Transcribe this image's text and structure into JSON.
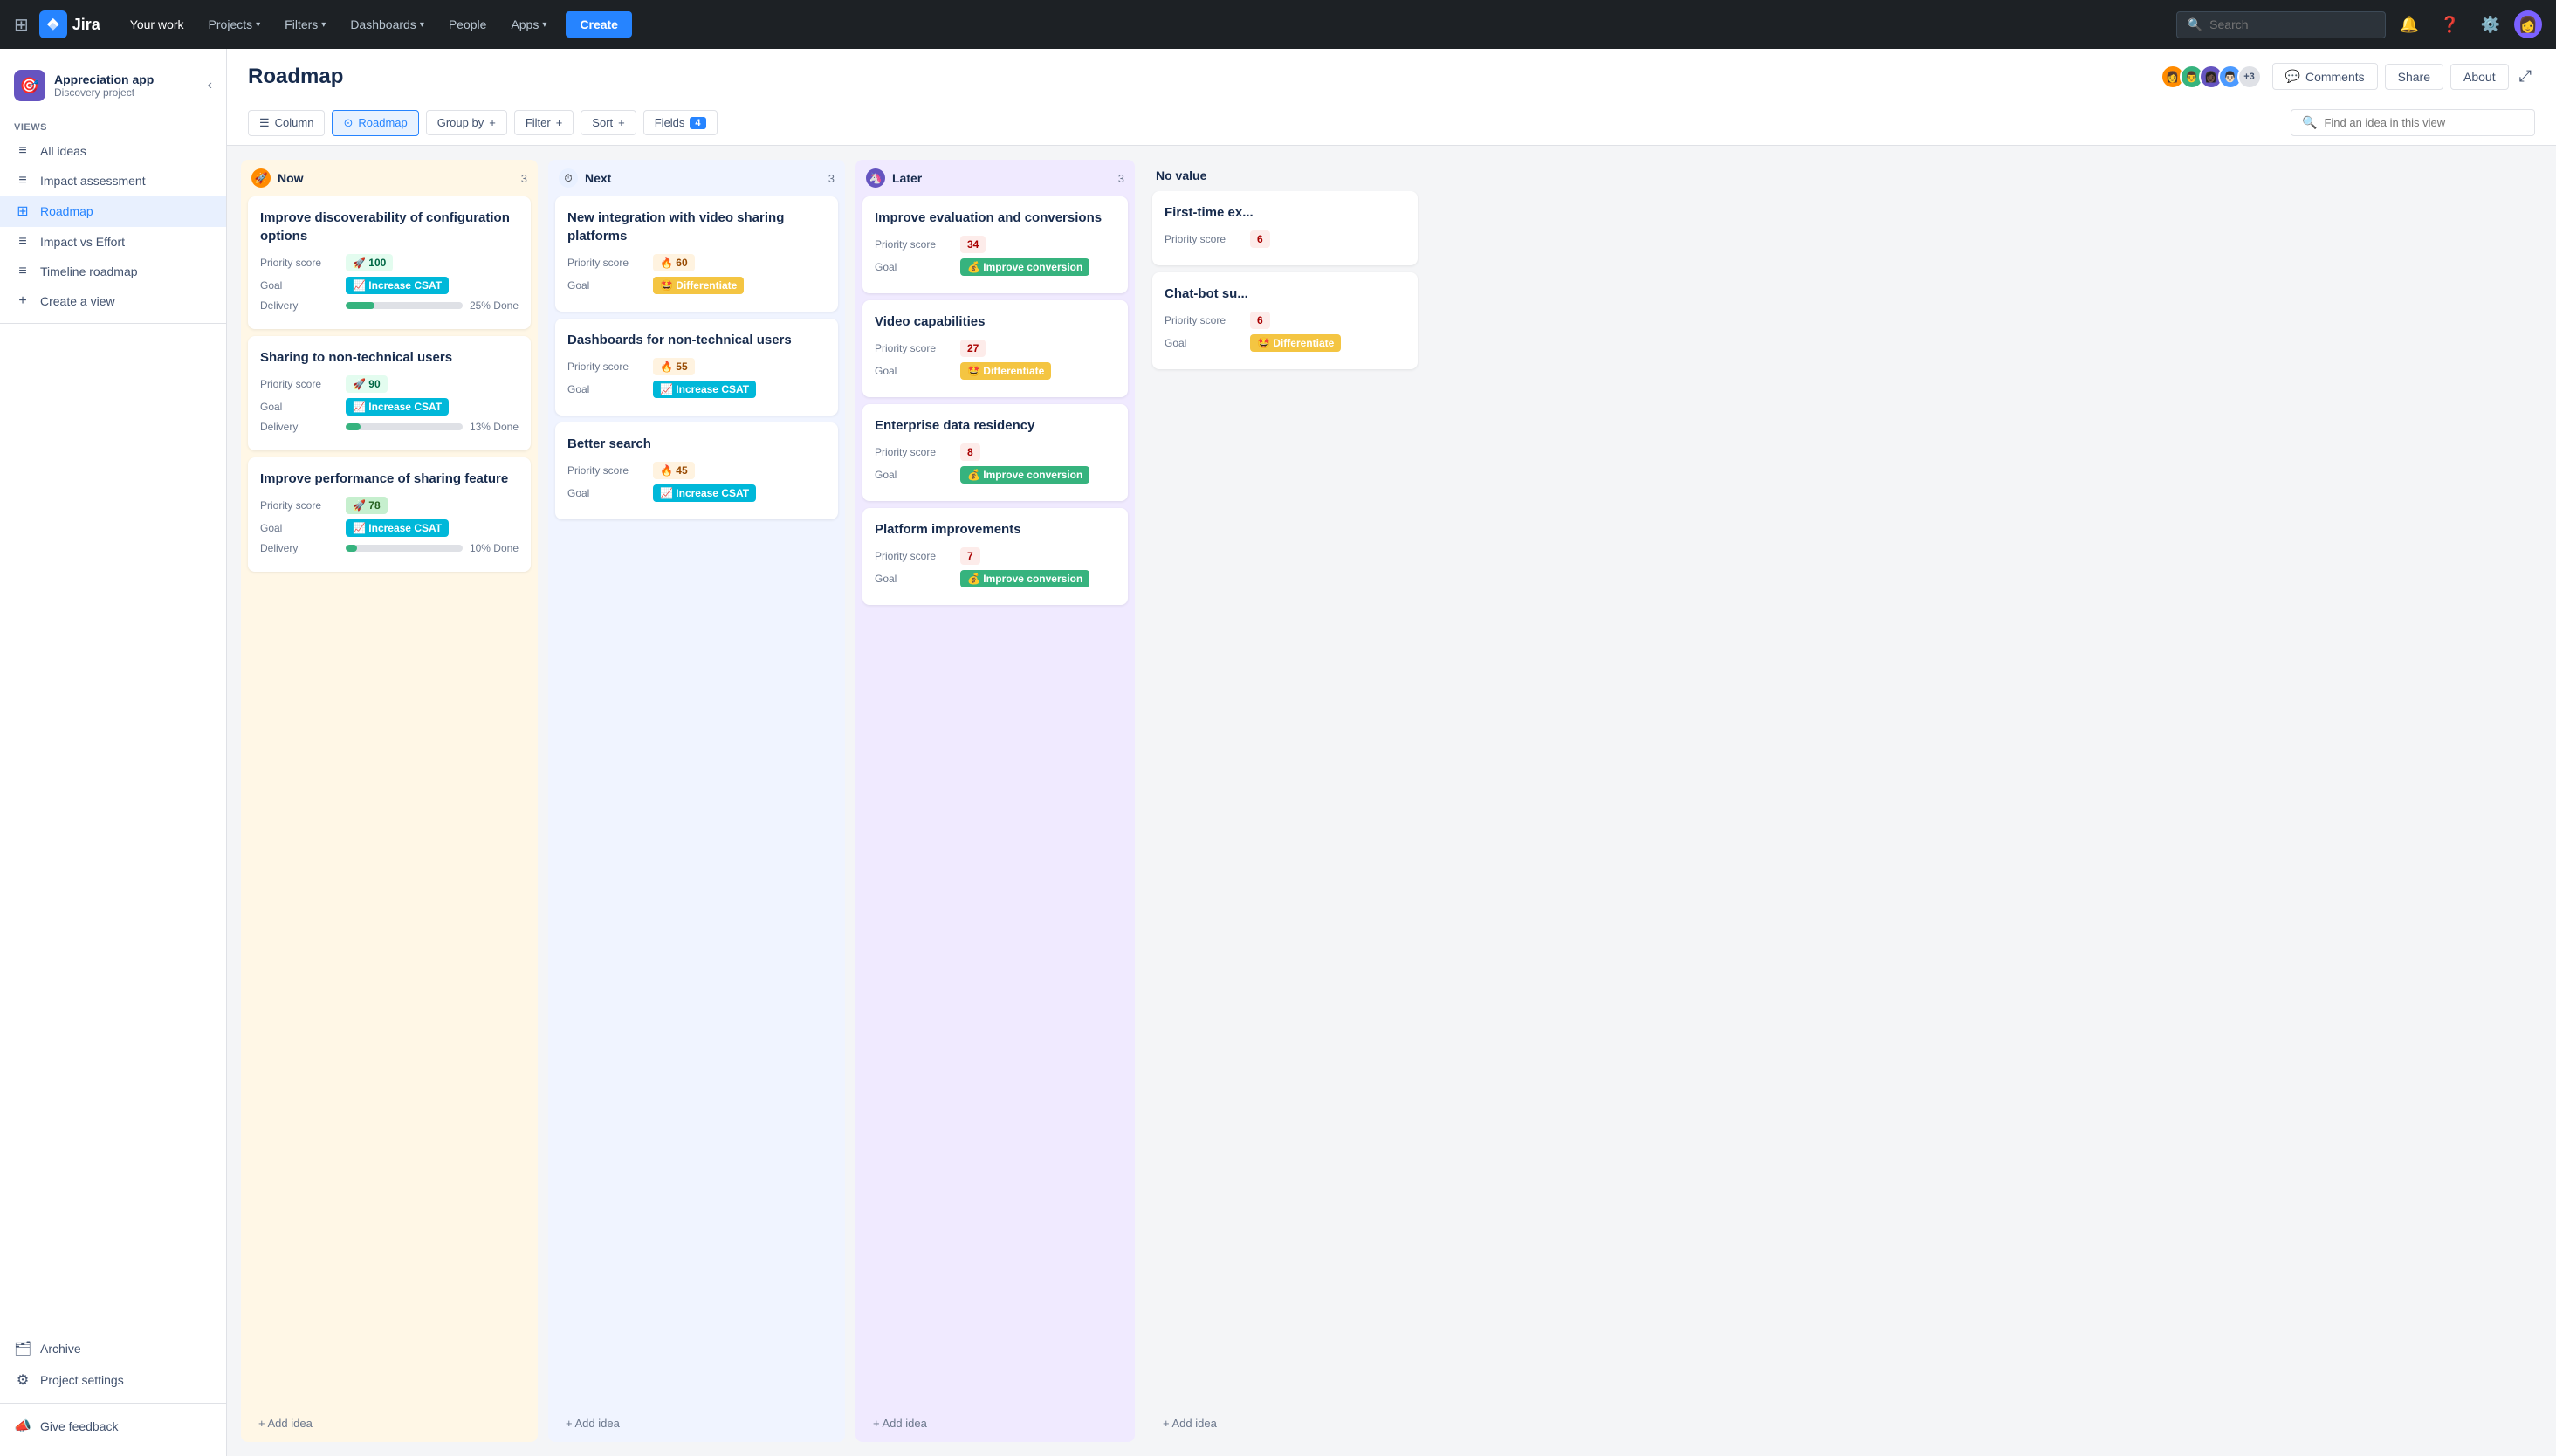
{
  "nav": {
    "logo_text": "Jira",
    "links": [
      "Your work",
      "Projects",
      "Filters",
      "Dashboards",
      "People",
      "Apps"
    ],
    "create_label": "Create",
    "search_placeholder": "Search"
  },
  "sidebar": {
    "project_name": "Appreciation app",
    "project_sub": "Discovery project",
    "views_label": "VIEWS",
    "views_add": "+",
    "items": [
      {
        "label": "All ideas",
        "icon": "≡",
        "active": false
      },
      {
        "label": "Impact assessment",
        "icon": "≡",
        "active": false
      },
      {
        "label": "Roadmap",
        "icon": "⊞",
        "active": true
      },
      {
        "label": "Impact vs Effort",
        "icon": "≡",
        "active": false
      },
      {
        "label": "Timeline roadmap",
        "icon": "≡",
        "active": false
      },
      {
        "label": "Create a view",
        "icon": "+",
        "active": false
      }
    ],
    "archive_label": "Archive",
    "project_settings_label": "Project settings",
    "give_feedback_label": "Give feedback"
  },
  "header": {
    "title": "Roadmap",
    "avatars": [
      "👩",
      "👨",
      "👩🏿",
      "👨🏻"
    ],
    "avatar_count": "+3",
    "comments_label": "Comments",
    "share_label": "Share",
    "about_label": "About"
  },
  "toolbar": {
    "column_label": "Column",
    "roadmap_label": "Roadmap",
    "group_by_label": "Group by",
    "filter_label": "Filter",
    "sort_label": "Sort",
    "fields_label": "Fields",
    "fields_count": "4",
    "search_placeholder": "Find an idea in this view"
  },
  "columns": [
    {
      "id": "now",
      "emoji": "🚀",
      "title": "Now",
      "count": 3,
      "style": "now",
      "cards": [
        {
          "title": "Improve discoverability of configuration options",
          "priority_score": "100",
          "score_class": "score-100",
          "score_emoji": "🚀",
          "goal_label": "Increase CSAT",
          "goal_color": "badge-goal-teal",
          "goal_icon": "📈",
          "has_delivery": true,
          "delivery_progress": 25,
          "delivery_label": "25% Done"
        },
        {
          "title": "Sharing to non-technical users",
          "priority_score": "90",
          "score_class": "score-90",
          "score_emoji": "🚀",
          "goal_label": "Increase CSAT",
          "goal_color": "badge-goal-teal",
          "goal_icon": "📈",
          "has_delivery": true,
          "delivery_progress": 13,
          "delivery_label": "13% Done"
        },
        {
          "title": "Improve performance of sharing feature",
          "priority_score": "78",
          "score_class": "score-78",
          "score_emoji": "🚀",
          "goal_label": "Increase CSAT",
          "goal_color": "badge-goal-teal",
          "goal_icon": "📈",
          "has_delivery": true,
          "delivery_progress": 10,
          "delivery_label": "10% Done"
        }
      ],
      "add_idea_label": "+ Add idea"
    },
    {
      "id": "next",
      "emoji": "⏱",
      "title": "Next",
      "count": 3,
      "style": "next",
      "cards": [
        {
          "title": "New integration with video sharing platforms",
          "priority_score": "60",
          "score_class": "score-60",
          "score_emoji": "🔥",
          "goal_label": "Differentiate",
          "goal_color": "badge-goal-yellow",
          "goal_icon": "🤩",
          "has_delivery": false
        },
        {
          "title": "Dashboards for non-technical users",
          "priority_score": "55",
          "score_class": "score-55",
          "score_emoji": "🔥",
          "goal_label": "Increase CSAT",
          "goal_color": "badge-goal-teal",
          "goal_icon": "📈",
          "has_delivery": false
        },
        {
          "title": "Better search",
          "priority_score": "45",
          "score_class": "score-45",
          "score_emoji": "🔥",
          "goal_label": "Increase CSAT",
          "goal_color": "badge-goal-teal",
          "goal_icon": "📈",
          "has_delivery": false
        }
      ],
      "add_idea_label": "+ Add idea"
    },
    {
      "id": "later",
      "emoji": "🦄",
      "title": "Later",
      "count": 3,
      "style": "later",
      "cards": [
        {
          "title": "Improve evaluation and conversions",
          "priority_score": "34",
          "score_class": "score-34",
          "score_emoji": "",
          "goal_label": "Improve conversion",
          "goal_color": "badge-goal-green",
          "goal_icon": "💰",
          "has_delivery": false
        },
        {
          "title": "Video capabilities",
          "priority_score": "27",
          "score_class": "score-27",
          "score_emoji": "",
          "goal_label": "Differentiate",
          "goal_color": "badge-goal-yellow",
          "goal_icon": "🤩",
          "has_delivery": false
        },
        {
          "title": "Enterprise data residency",
          "priority_score": "8",
          "score_class": "score-8",
          "score_emoji": "",
          "goal_label": "Improve conversion",
          "goal_color": "badge-goal-green",
          "goal_icon": "💰",
          "has_delivery": false
        },
        {
          "title": "Platform improvements",
          "priority_score": "7",
          "score_class": "score-7",
          "score_emoji": "",
          "goal_label": "Improve conversion",
          "goal_color": "badge-goal-green",
          "goal_icon": "💰",
          "has_delivery": false
        }
      ],
      "add_idea_label": "+ Add idea"
    },
    {
      "id": "no-value",
      "emoji": "",
      "title": "No value",
      "count": null,
      "style": "no-value",
      "cards": [
        {
          "title": "First-time ex...",
          "priority_score": "6",
          "score_class": "score-6",
          "score_emoji": "",
          "goal_label": "",
          "goal_color": "",
          "goal_icon": "",
          "has_delivery": false,
          "truncated": true
        },
        {
          "title": "Chat-bot su...",
          "priority_score": "6",
          "score_class": "score-6",
          "score_emoji": "",
          "goal_label": "Differentiate",
          "goal_color": "badge-goal-yellow",
          "goal_icon": "🤩",
          "has_delivery": false,
          "truncated": true
        }
      ],
      "add_idea_label": "+ Add idea"
    }
  ]
}
